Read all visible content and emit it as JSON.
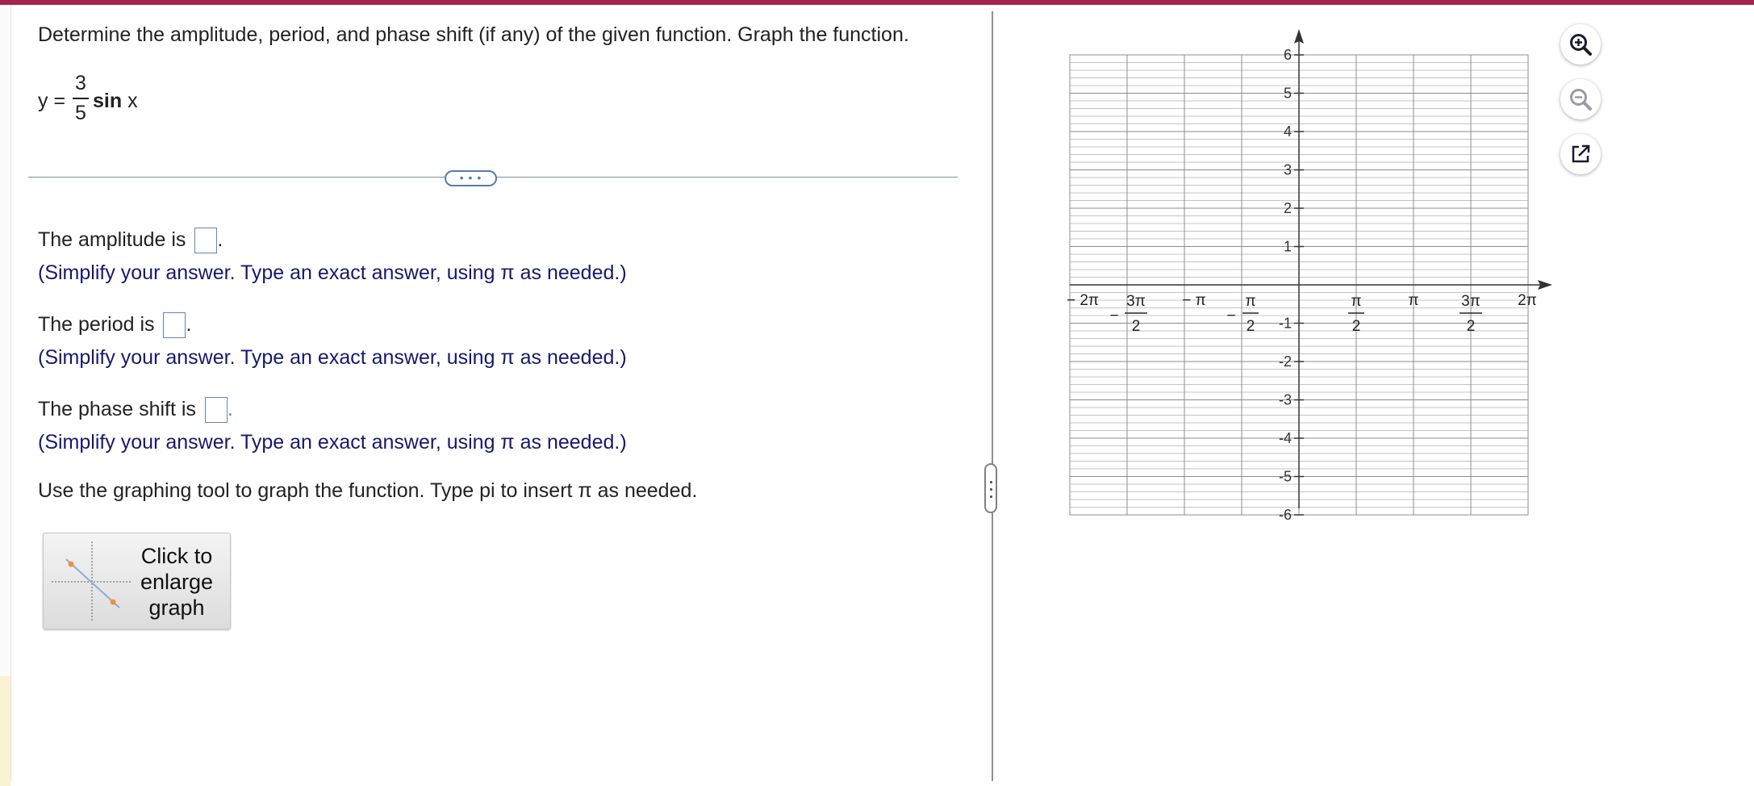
{
  "question": {
    "title": "Determine the amplitude, period, and phase shift (if any) of the given function. Graph the function.",
    "equation": {
      "lhs": "y =",
      "numerator": "3",
      "denominator": "5",
      "func": "sin",
      "var": "x"
    },
    "expander_label": "• • •",
    "amplitude": {
      "prompt": "The amplitude is",
      "hint": "(Simplify your answer. Type an exact answer, using π as needed.)"
    },
    "period": {
      "prompt": "The period is",
      "hint": "(Simplify your answer. Type an exact answer, using π as needed.)"
    },
    "phase_shift": {
      "prompt": "The phase shift is",
      "hint": "(Simplify your answer. Type an exact answer, using π as needed.)"
    },
    "instruction": "Use the graphing tool to graph the function. Type pi to insert π as needed.",
    "enlarge_button": "Click to\nenlarge\ngraph",
    "period_mark": "."
  },
  "graph": {
    "y_ticks": [
      "6",
      "5",
      "4",
      "3",
      "2",
      "1",
      "-1",
      "-2",
      "-3",
      "-4",
      "-5",
      "-6"
    ],
    "x_labels": {
      "neg_two_pi": "− 2π",
      "neg_three_pi_num": "3π",
      "neg_three_pi_den": "2",
      "neg_pi": "− π",
      "neg_half_pi_num": "π",
      "neg_half_pi_den": "2",
      "half_pi_num": "π",
      "half_pi_den": "2",
      "pi": "π",
      "three_pi_num": "3π",
      "three_pi_den": "2",
      "two_pi": "2π",
      "minus": "−"
    },
    "x_range": [
      "-2π",
      "2π"
    ],
    "y_range": [
      -6,
      6
    ],
    "grid": true
  },
  "tools": {
    "zoom_in": "zoom-in-icon",
    "zoom_out": "zoom-out-icon",
    "popout": "external-link-icon"
  },
  "colors": {
    "top_bar": "#a5224c",
    "hint_text": "#18186e",
    "answer_box_border": "#5f86bd",
    "tool_icon": "#1a1a2e"
  }
}
